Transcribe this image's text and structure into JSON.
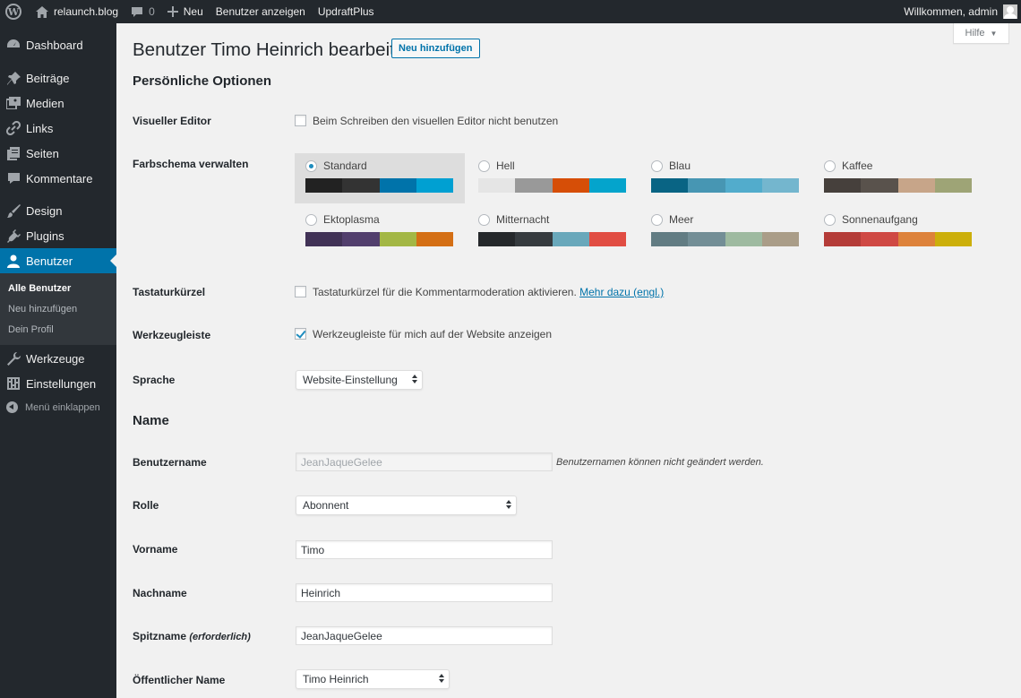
{
  "adminbar": {
    "site_name": "relaunch.blog",
    "comments_count": "0",
    "new_label": "Neu",
    "view_users_label": "Benutzer anzeigen",
    "updraft_label": "UpdraftPlus",
    "welcome": "Willkommen, admin"
  },
  "sidebar": {
    "items": [
      {
        "label": "Dashboard",
        "icon": "dashboard-icon"
      },
      {
        "label": "Beiträge",
        "icon": "pin-icon"
      },
      {
        "label": "Medien",
        "icon": "media-icon"
      },
      {
        "label": "Links",
        "icon": "link-icon"
      },
      {
        "label": "Seiten",
        "icon": "page-icon"
      },
      {
        "label": "Kommentare",
        "icon": "comment-icon"
      },
      {
        "label": "Design",
        "icon": "brush-icon"
      },
      {
        "label": "Plugins",
        "icon": "plugin-icon"
      },
      {
        "label": "Benutzer",
        "icon": "user-icon"
      },
      {
        "label": "Werkzeuge",
        "icon": "wrench-icon"
      },
      {
        "label": "Einstellungen",
        "icon": "settings-icon"
      }
    ],
    "submenu": [
      "Alle Benutzer",
      "Neu hinzufügen",
      "Dein Profil"
    ],
    "collapse_label": "Menü einklappen"
  },
  "header": {
    "help_label": "Hilfe",
    "title": "Benutzer Timo Heinrich bearbeiten",
    "add_new_label": "Neu hinzufügen"
  },
  "personal": {
    "heading": "Persönliche Optionen",
    "visual_editor": {
      "label": "Visueller Editor",
      "checkbox_label": "Beim Schreiben den visuellen Editor nicht benutzen",
      "checked": false
    },
    "color_scheme": {
      "label": "Farbschema verwalten",
      "selected": "Standard",
      "schemes": [
        {
          "name": "Standard",
          "colors": [
            "#222222",
            "#333333",
            "#0073aa",
            "#00a0d2"
          ]
        },
        {
          "name": "Hell",
          "colors": [
            "#e5e5e5",
            "#999999",
            "#d64e07",
            "#04a4cc"
          ]
        },
        {
          "name": "Blau",
          "colors": [
            "#096484",
            "#4796b3",
            "#52accc",
            "#74b6ce"
          ]
        },
        {
          "name": "Kaffee",
          "colors": [
            "#46403c",
            "#59524c",
            "#c7a589",
            "#9ea476"
          ]
        },
        {
          "name": "Ektoplasma",
          "colors": [
            "#413256",
            "#523f6d",
            "#a3b745",
            "#d46f15"
          ]
        },
        {
          "name": "Mitternacht",
          "colors": [
            "#25282b",
            "#363b3f",
            "#69a8bb",
            "#e14d43"
          ]
        },
        {
          "name": "Meer",
          "colors": [
            "#627c83",
            "#738e96",
            "#9ebaa0",
            "#aa9d88"
          ]
        },
        {
          "name": "Sonnenaufgang",
          "colors": [
            "#b43c38",
            "#cf4944",
            "#dd823b",
            "#ccaf0b"
          ]
        }
      ]
    },
    "keyboard": {
      "label": "Tastaturkürzel",
      "checkbox_label": "Tastaturkürzel für die Kommentarmoderation aktivieren.",
      "link": "Mehr dazu (engl.)",
      "checked": false
    },
    "toolbar": {
      "label": "Werkzeugleiste",
      "checkbox_label": "Werkzeugleiste für mich auf der Website anzeigen",
      "checked": true
    },
    "language": {
      "label": "Sprache",
      "value": "Website-Einstellung"
    }
  },
  "name": {
    "heading": "Name",
    "username": {
      "label": "Benutzername",
      "value": "JeanJaqueGelee",
      "description": "Benutzernamen können nicht geändert werden."
    },
    "role": {
      "label": "Rolle",
      "value": "Abonnent"
    },
    "first_name": {
      "label": "Vorname",
      "value": "Timo"
    },
    "last_name": {
      "label": "Nachname",
      "value": "Heinrich"
    },
    "nickname": {
      "label": "Spitzname",
      "required": "(erforderlich)",
      "value": "JeanJaqueGelee"
    },
    "display_name": {
      "label": "Öffentlicher Name",
      "value": "Timo Heinrich"
    }
  }
}
